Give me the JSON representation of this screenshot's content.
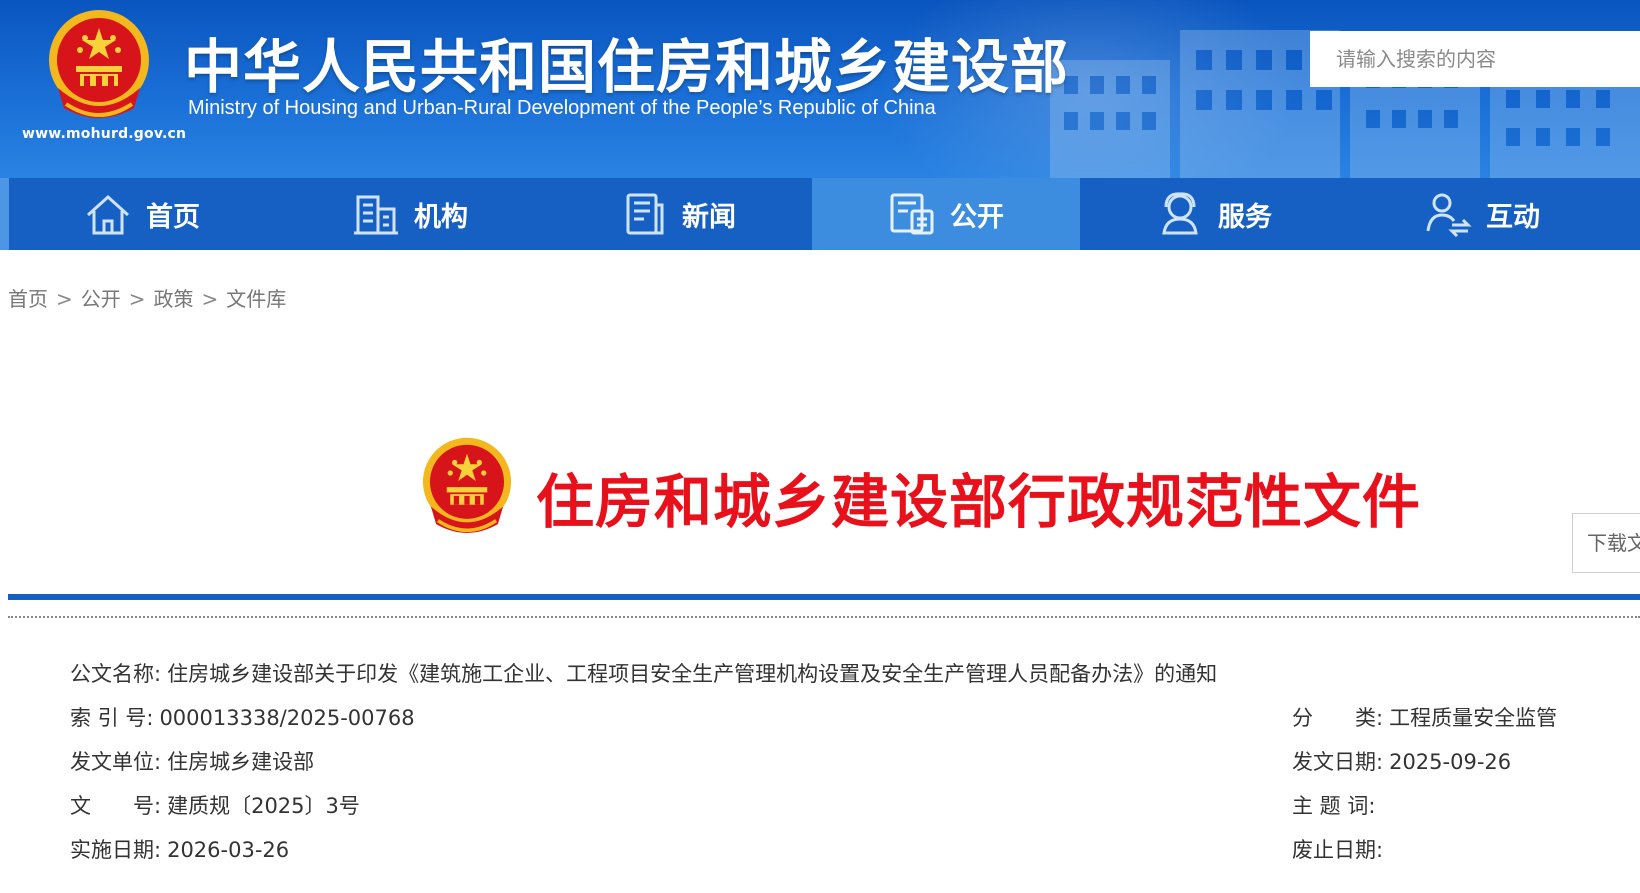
{
  "site": {
    "title": "中华人民共和国住房和城乡建设部",
    "subtitle": "Ministry of Housing and Urban-Rural Development of the People’s Republic of China",
    "url": "www.mohurd.gov.cn"
  },
  "search": {
    "placeholder": "请输入搜索的内容"
  },
  "nav": {
    "items": [
      {
        "label": "首页",
        "icon": "home-icon"
      },
      {
        "label": "机构",
        "icon": "building-icon"
      },
      {
        "label": "新闻",
        "icon": "news-icon"
      },
      {
        "label": "公开",
        "icon": "disclosure-icon",
        "active": true
      },
      {
        "label": "服务",
        "icon": "service-icon"
      },
      {
        "label": "互动",
        "icon": "interaction-icon"
      }
    ]
  },
  "breadcrumb": {
    "items": [
      "首页",
      "公开",
      "政策",
      "文件库"
    ],
    "separator": ">"
  },
  "document": {
    "heading": "住房和城乡建设部行政规范性文件",
    "download_label": "下载文件"
  },
  "meta": {
    "name_label": "公文名称:",
    "name_value": "住房城乡建设部关于印发《建筑施工企业、工程项目安全生产管理机构设置及安全生产管理人员配备办法》的通知",
    "index_label": "索 引 号:",
    "index_value": "000013338/2025-00768",
    "category_label": "分　　类:",
    "category_value": "工程质量安全监管",
    "issuer_label": "发文单位:",
    "issuer_value": "住房城乡建设部",
    "issue_date_label": "发文日期:",
    "issue_date_value": "2025-09-26",
    "doc_no_label": "文　　号:",
    "doc_no_value": "建质规〔2025〕3号",
    "keywords_label": "主 题 词:",
    "keywords_value": "",
    "effective_label": "实施日期:",
    "effective_value": "2026-03-26",
    "repeal_label": "废止日期:",
    "repeal_value": ""
  },
  "colors": {
    "header_blue": "#1a6fd6",
    "nav_blue": "#1660c4",
    "nav_active": "#3c8de0",
    "heading_red": "#e8101a",
    "rule_blue": "#1560c2"
  }
}
